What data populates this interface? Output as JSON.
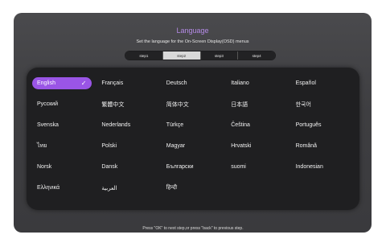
{
  "header": {
    "title": "Language",
    "subtitle": "Set the language for the On-Screen Display(OSD) menus"
  },
  "steps": [
    "step1",
    "step2",
    "step3",
    "step4"
  ],
  "active_step": "step2",
  "languages": [
    "English",
    "Français",
    "Deutsch",
    "Italiano",
    "Español",
    "Русский",
    "繁體中文",
    "简体中文",
    "日本語",
    "한국어",
    "Svenska",
    "Nederlands",
    "Türkçe",
    "Čeština",
    "Português",
    "ไทย",
    "Polski",
    "Magyar",
    "Hrvatski",
    "Română",
    "Norsk",
    "Dansk",
    "Български",
    "suomi",
    "Indonesian",
    "Ελληνικά",
    "العربية",
    "हिन्दी"
  ],
  "selected_language": "English",
  "footer": "Press \"OK\" to next step,or press \"back\" to previous step.",
  "colors": {
    "accent": "#9a55e6",
    "title": "#b48ae6",
    "panel": "#1f1f21",
    "background": "#3e3e41"
  },
  "icons": {
    "selected_marker": "check-icon"
  }
}
